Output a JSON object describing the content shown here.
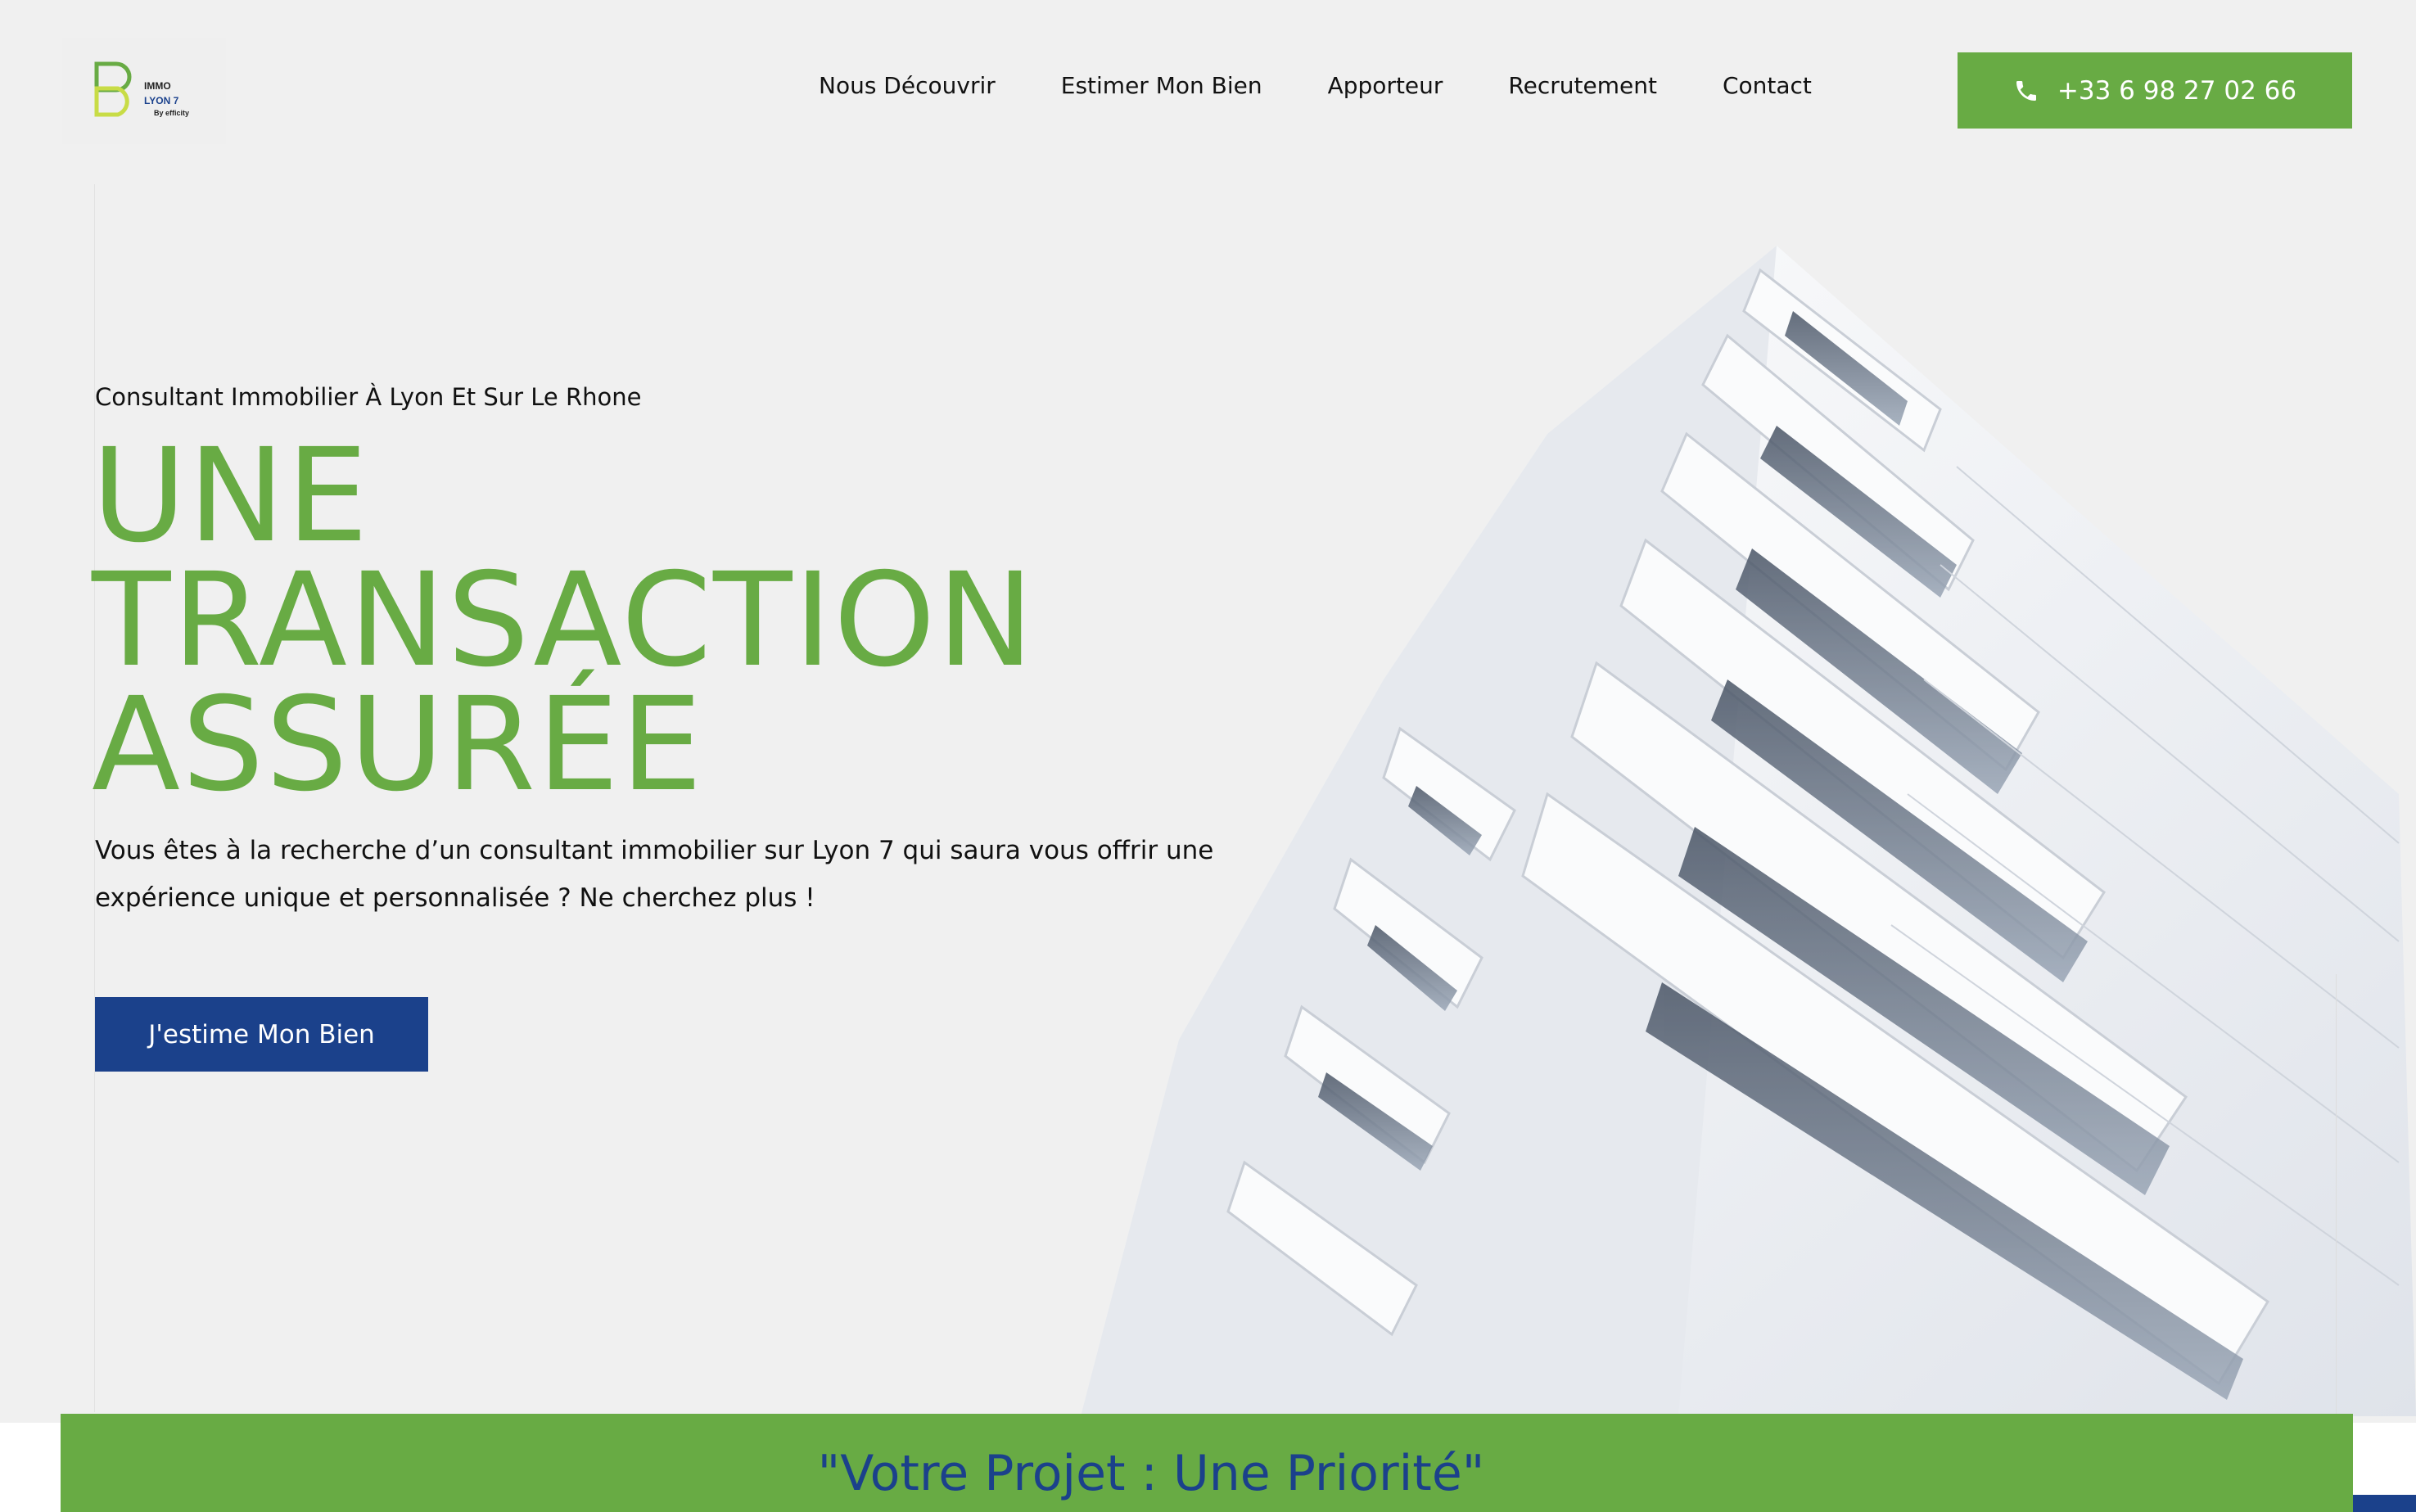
{
  "logo": {
    "line1": "IMMO",
    "line2": "LYON 7",
    "line3": "By efficity"
  },
  "nav": {
    "items": [
      {
        "label": "Nous Découvrir"
      },
      {
        "label": "Estimer Mon Bien"
      },
      {
        "label": "Apporteur"
      },
      {
        "label": "Recrutement"
      },
      {
        "label": "Contact"
      }
    ]
  },
  "phone": {
    "icon": "phone-icon",
    "label": "+33 6 98 27 02 66"
  },
  "hero": {
    "subtitle": "Consultant Immobilier À Lyon Et Sur Le Rhone",
    "headline": [
      "UNE",
      "TRANSACTION",
      "ASSURÉE"
    ],
    "description": "Vous êtes à la recherche d’un consultant immobilier sur Lyon 7 qui saura vous offrir une expérience unique et personnalisée ? Ne cherchez plus !",
    "cta_label": "J'estime Mon Bien"
  },
  "band": {
    "text": "\"Votre Projet : Une Priorité\""
  },
  "colors": {
    "green": "#68ab44",
    "blue": "#1b418b",
    "background": "#f0f0f0"
  }
}
